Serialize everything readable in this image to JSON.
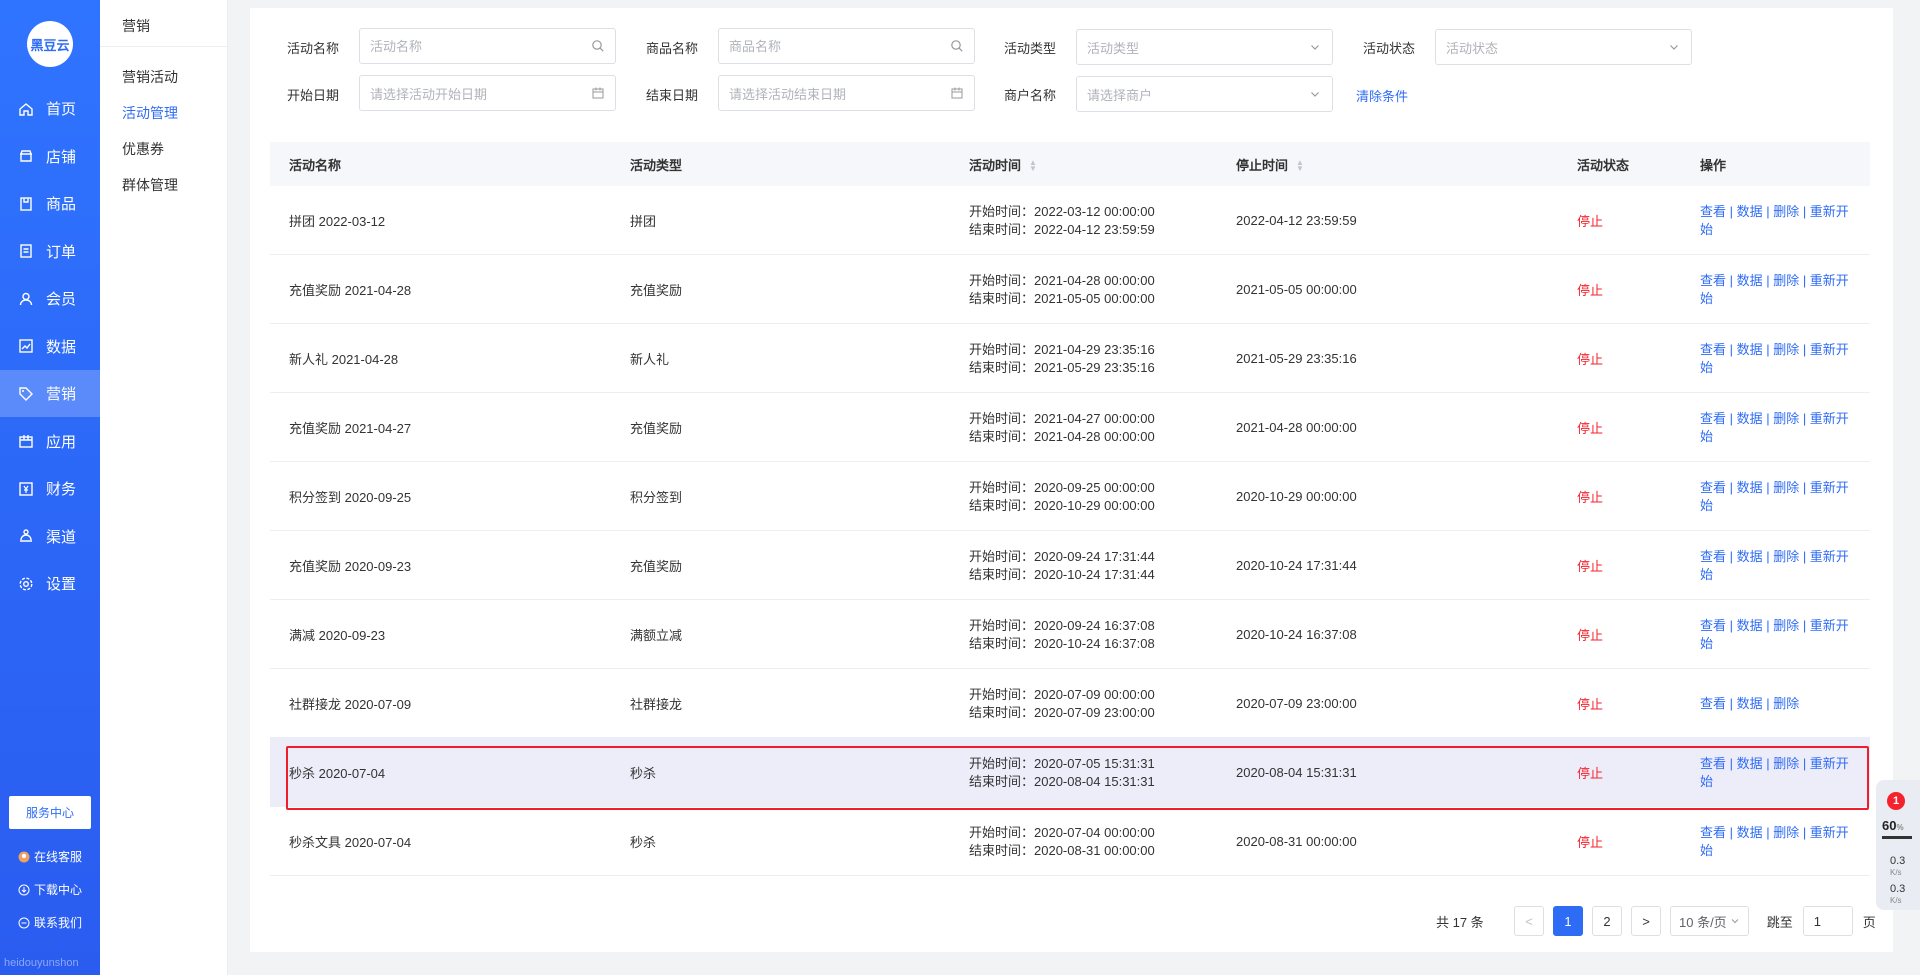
{
  "brand": {
    "logo_text": "黑豆云",
    "footer_text": "heidouyunshon"
  },
  "sidebar": {
    "items": [
      {
        "label": "首页",
        "icon": "home-icon"
      },
      {
        "label": "店铺",
        "icon": "store-icon"
      },
      {
        "label": "商品",
        "icon": "goods-icon"
      },
      {
        "label": "订单",
        "icon": "order-icon"
      },
      {
        "label": "会员",
        "icon": "member-icon"
      },
      {
        "label": "数据",
        "icon": "chart-icon"
      },
      {
        "label": "营销",
        "icon": "tag-icon"
      },
      {
        "label": "应用",
        "icon": "app-icon"
      },
      {
        "label": "财务",
        "icon": "finance-icon"
      },
      {
        "label": "渠道",
        "icon": "channel-icon"
      },
      {
        "label": "设置",
        "icon": "gear-icon"
      }
    ],
    "active_index": 6,
    "service_button": "服务中心",
    "bottom_links": [
      {
        "label": "在线客服",
        "icon": "chat-icon"
      },
      {
        "label": "下载中心",
        "icon": "download-icon"
      },
      {
        "label": "联系我们",
        "icon": "contact-icon"
      }
    ]
  },
  "subnav": {
    "title": "营销",
    "items": [
      "营销活动",
      "活动管理",
      "优惠券",
      "群体管理"
    ],
    "active_index": 1
  },
  "filters": {
    "activity_name": {
      "label": "活动名称",
      "placeholder": "活动名称"
    },
    "product_name": {
      "label": "商品名称",
      "placeholder": "商品名称"
    },
    "activity_type": {
      "label": "活动类型",
      "placeholder": "活动类型"
    },
    "activity_status": {
      "label": "活动状态",
      "placeholder": "活动状态"
    },
    "start_date": {
      "label": "开始日期",
      "placeholder": "请选择活动开始日期"
    },
    "end_date": {
      "label": "结束日期",
      "placeholder": "请选择活动结束日期"
    },
    "merchant": {
      "label": "商户名称",
      "placeholder": "请选择商户"
    },
    "clear_label": "清除条件"
  },
  "table": {
    "columns": [
      "活动名称",
      "活动类型",
      "活动时间",
      "停止时间",
      "活动状态",
      "操作"
    ],
    "start_prefix": "开始时间：",
    "end_prefix": "结束时间：",
    "rows": [
      {
        "name": "拼团 2022-03-12",
        "type": "拼团",
        "start": "2022-03-12 00:00:00",
        "end": "2022-04-12 23:59:59",
        "stop": "2022-04-12 23:59:59",
        "status": "停止",
        "ops_line1": "查看 | 数据 | 删除 | 重新开",
        "ops_line2": "始"
      },
      {
        "name": "充值奖励 2021-04-28",
        "type": "充值奖励",
        "start": "2021-04-28 00:00:00",
        "end": "2021-05-05 00:00:00",
        "stop": "2021-05-05 00:00:00",
        "status": "停止",
        "ops_line1": "查看 | 数据 | 删除 | 重新开",
        "ops_line2": "始"
      },
      {
        "name": "新人礼 2021-04-28",
        "type": "新人礼",
        "start": "2021-04-29 23:35:16",
        "end": "2021-05-29 23:35:16",
        "stop": "2021-05-29 23:35:16",
        "status": "停止",
        "ops_line1": "查看 | 数据 | 删除 | 重新开",
        "ops_line2": "始"
      },
      {
        "name": "充值奖励 2021-04-27",
        "type": "充值奖励",
        "start": "2021-04-27 00:00:00",
        "end": "2021-04-28 00:00:00",
        "stop": "2021-04-28 00:00:00",
        "status": "停止",
        "ops_line1": "查看 | 数据 | 删除 | 重新开",
        "ops_line2": "始"
      },
      {
        "name": "积分签到 2020-09-25",
        "type": "积分签到",
        "start": "2020-09-25 00:00:00",
        "end": "2020-10-29 00:00:00",
        "stop": "2020-10-29 00:00:00",
        "status": "停止",
        "ops_line1": "查看 | 数据 | 删除 | 重新开",
        "ops_line2": "始"
      },
      {
        "name": "充值奖励 2020-09-23",
        "type": "充值奖励",
        "start": "2020-09-24 17:31:44",
        "end": "2020-10-24 17:31:44",
        "stop": "2020-10-24 17:31:44",
        "status": "停止",
        "ops_line1": "查看 | 数据 | 删除 | 重新开",
        "ops_line2": "始"
      },
      {
        "name": "满减 2020-09-23",
        "type": "满额立减",
        "start": "2020-09-24 16:37:08",
        "end": "2020-10-24 16:37:08",
        "stop": "2020-10-24 16:37:08",
        "status": "停止",
        "ops_line1": "查看 | 数据 | 删除 | 重新开",
        "ops_line2": "始"
      },
      {
        "name": "社群接龙 2020-07-09",
        "type": "社群接龙",
        "start": "2020-07-09 00:00:00",
        "end": "2020-07-09 23:00:00",
        "stop": "2020-07-09 23:00:00",
        "status": "停止",
        "ops_line1": "查看 | 数据 | 删除",
        "ops_line2": ""
      },
      {
        "name": "秒杀 2020-07-04",
        "type": "秒杀",
        "start": "2020-07-05 15:31:31",
        "end": "2020-08-04 15:31:31",
        "stop": "2020-08-04 15:31:31",
        "status": "停止",
        "ops_line1": "查看 | 数据 | 删除 | 重新开",
        "ops_line2": "始"
      },
      {
        "name": "秒杀文具 2020-07-04",
        "type": "秒杀",
        "start": "2020-07-04 00:00:00",
        "end": "2020-08-31 00:00:00",
        "stop": "2020-08-31 00:00:00",
        "status": "停止",
        "ops_line1": "查看 | 数据 | 删除 | 重新开",
        "ops_line2": "始"
      }
    ],
    "highlight_index": 8
  },
  "pagination": {
    "total_text": "共 17 条",
    "prev_label": "<",
    "pages": [
      "1",
      "2"
    ],
    "current_page": "1",
    "next_label": ">",
    "page_size": "10 条/页",
    "jump_label": "跳至",
    "jump_value": "1",
    "page_suffix": "页"
  },
  "float_widget": {
    "badge": "1",
    "percent": "60",
    "percent_unit": "%",
    "up_speed": "0.3",
    "down_speed": "0.3",
    "speed_unit": "K/s"
  },
  "colors": {
    "primary": "#2f6cf5",
    "sidebar": "#2a5cf0",
    "danger": "#f5222d",
    "highlight_row": "#ededfa",
    "annotation_box": "#f01e2c"
  }
}
